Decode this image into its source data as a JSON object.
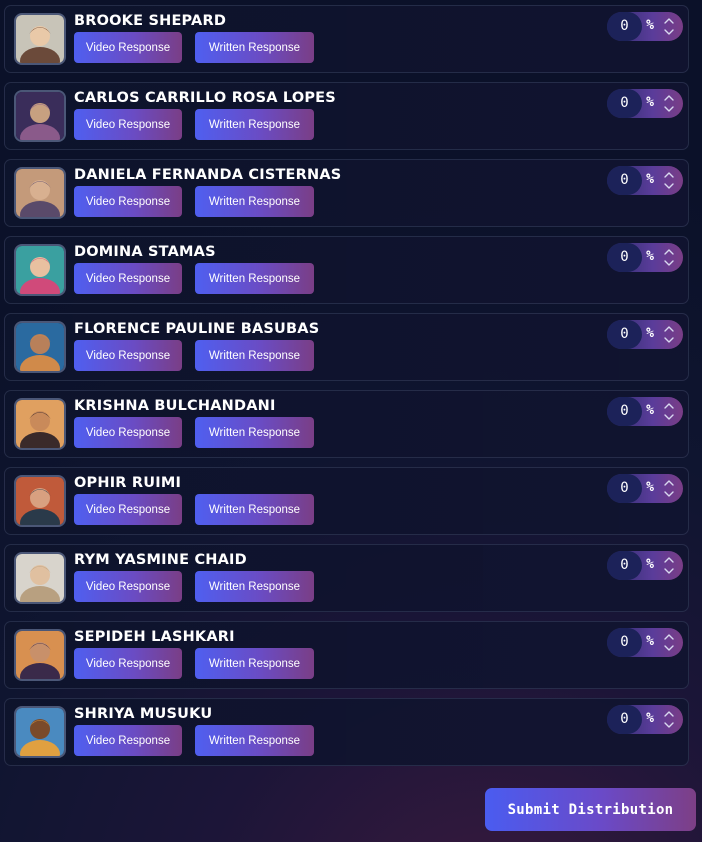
{
  "participants": [
    {
      "name": "BROOKE SHEPARD",
      "avatar": "avatar-portrait-icon",
      "video_label": "Video Response",
      "written_label": "Written Response",
      "percent": "0",
      "percent_sign": "%",
      "colors": [
        "#c8c4b8",
        "#6b4a3a",
        "#e9c9a8"
      ]
    },
    {
      "name": "CARLOS CARRILLO ROSA LOPES",
      "avatar": "avatar-portrait-icon",
      "video_label": "Video Response",
      "written_label": "Written Response",
      "percent": "0",
      "percent_sign": "%",
      "colors": [
        "#3a2d5a",
        "#8a5a8a",
        "#c7a080"
      ]
    },
    {
      "name": "DANIELA FERNANDA CISTERNAS",
      "avatar": "avatar-portrait-icon",
      "video_label": "Video Response",
      "written_label": "Written Response",
      "percent": "0",
      "percent_sign": "%",
      "colors": [
        "#c49a7a",
        "#5a4a6a",
        "#d8b090"
      ]
    },
    {
      "name": "DOMINA STAMAS",
      "avatar": "avatar-portrait-icon",
      "video_label": "Video Response",
      "written_label": "Written Response",
      "percent": "0",
      "percent_sign": "%",
      "colors": [
        "#3aa0a0",
        "#d04a7a",
        "#e8c0a0"
      ]
    },
    {
      "name": "FLORENCE PAULINE BASUBAS",
      "avatar": "avatar-portrait-icon",
      "video_label": "Video Response",
      "written_label": "Written Response",
      "percent": "0",
      "percent_sign": "%",
      "colors": [
        "#2a6aa0",
        "#d08a4a",
        "#b8805a"
      ]
    },
    {
      "name": "KRISHNA BULCHANDANI",
      "avatar": "avatar-portrait-icon",
      "video_label": "Video Response",
      "written_label": "Written Response",
      "percent": "0",
      "percent_sign": "%",
      "colors": [
        "#e0a060",
        "#3a2a2a",
        "#c98a5a"
      ]
    },
    {
      "name": "OPHIR RUIMI",
      "avatar": "avatar-portrait-icon",
      "video_label": "Video Response",
      "written_label": "Written Response",
      "percent": "0",
      "percent_sign": "%",
      "colors": [
        "#c05a3a",
        "#2a3a4a",
        "#d8a080"
      ]
    },
    {
      "name": "RYM YASMINE CHAID",
      "avatar": "avatar-portrait-icon",
      "video_label": "Video Response",
      "written_label": "Written Response",
      "percent": "0",
      "percent_sign": "%",
      "colors": [
        "#d8d4cc",
        "#b8a080",
        "#e0c0a0"
      ]
    },
    {
      "name": "SEPIDEH LASHKARI",
      "avatar": "avatar-portrait-icon",
      "video_label": "Video Response",
      "written_label": "Written Response",
      "percent": "0",
      "percent_sign": "%",
      "colors": [
        "#d89050",
        "#3a2a4a",
        "#c8906a"
      ]
    },
    {
      "name": "SHRIYA MUSUKU",
      "avatar": "avatar-portrait-icon",
      "video_label": "Video Response",
      "written_label": "Written Response",
      "percent": "0",
      "percent_sign": "%",
      "colors": [
        "#4a8ac0",
        "#e0a040",
        "#7a4a2a"
      ]
    }
  ],
  "submit_label": "Submit Distribution",
  "icons": {
    "spinner": "chevron-up-down-icon"
  }
}
